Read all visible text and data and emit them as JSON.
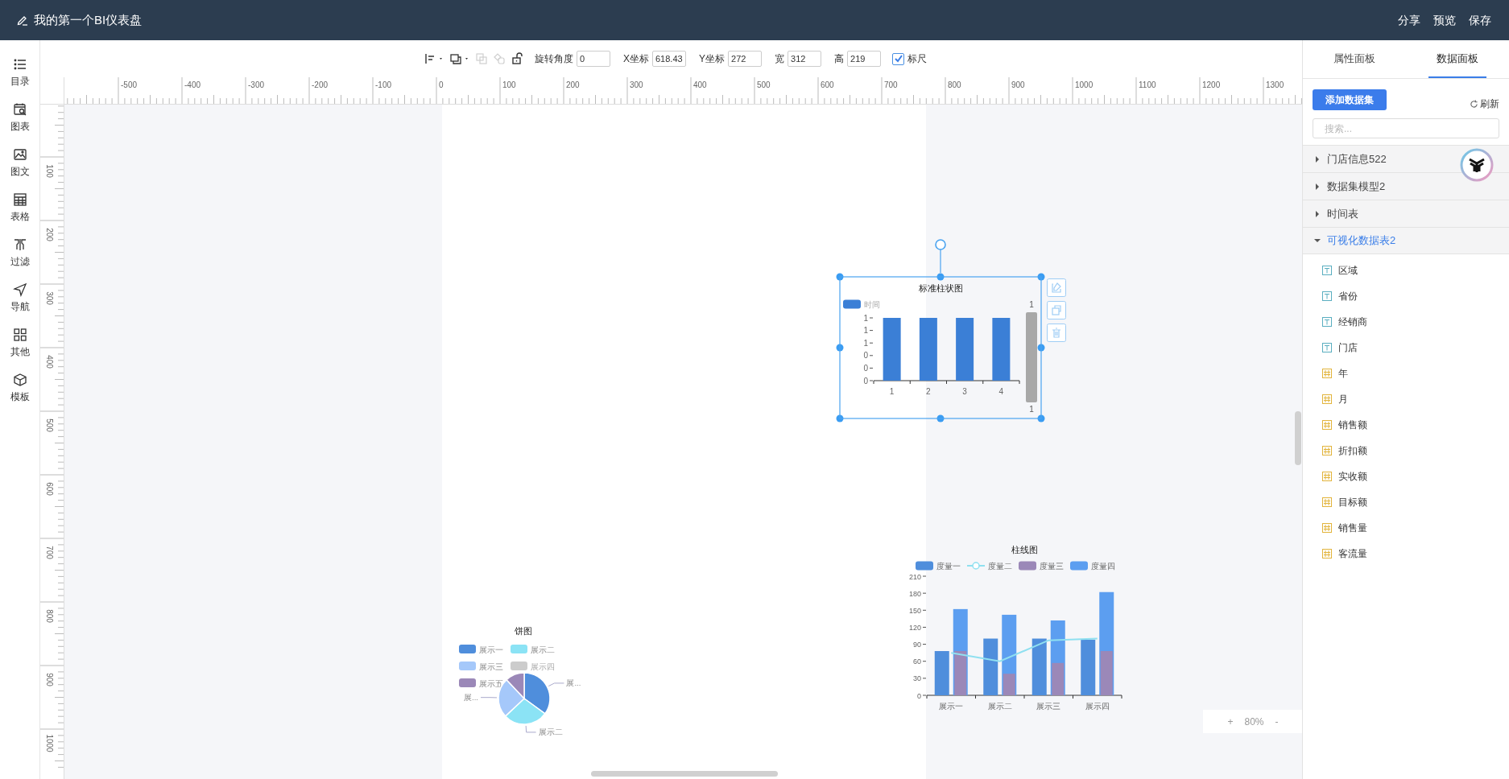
{
  "window": {
    "title": "我的第一个BI仪表盘"
  },
  "header_actions": [
    "分享",
    "预览",
    "保存"
  ],
  "sidebar": {
    "items": [
      {
        "label": "目录"
      },
      {
        "label": "图表"
      },
      {
        "label": "图文"
      },
      {
        "label": "表格"
      },
      {
        "label": "过滤"
      },
      {
        "label": "导航"
      },
      {
        "label": "其他"
      },
      {
        "label": "模板"
      }
    ]
  },
  "toolbar": {
    "tools": [
      {
        "disabled": false
      },
      {
        "disabled": false
      },
      {
        "disabled": true
      },
      {
        "disabled": true
      },
      {
        "disabled": false
      }
    ],
    "fields": [
      {
        "label": "旋转角度",
        "value": "0"
      },
      {
        "label": "X坐标",
        "value": "618.43"
      },
      {
        "label": "Y坐标",
        "value": "272"
      },
      {
        "label": "宽",
        "value": "312"
      },
      {
        "label": "高",
        "value": "219"
      }
    ],
    "ruler_toggle": {
      "label": "标尺",
      "checked": true
    }
  },
  "ruler": {
    "top_labels": [
      "-500",
      "-400",
      "-300",
      "-200",
      "-100",
      "0",
      "100",
      "200",
      "300",
      "400",
      "500",
      "600",
      "700",
      "800",
      "900",
      "1000",
      "1100",
      "1200",
      "1300"
    ],
    "left_labels": [
      "100",
      "200",
      "300",
      "400",
      "500",
      "600",
      "700",
      "800",
      "900",
      "1000"
    ]
  },
  "widgets": [
    {
      "selected": true,
      "slider": {
        "start": "1",
        "end": "1"
      },
      "chart_data": {
        "type": "bar",
        "title": "标准柱状图",
        "legend": "top-left",
        "categories": [
          "1",
          "2",
          "3",
          "4"
        ],
        "series": [
          {
            "name": "时间",
            "color": "#3b7fd6",
            "values": [
              1,
              1,
              1,
              1
            ]
          }
        ],
        "ylim": [
          0,
          1
        ],
        "yticks": [
          {
            "value": 0,
            "label": "0"
          },
          {
            "value": 0.2,
            "label": "0"
          },
          {
            "value": 0.4,
            "label": "0"
          },
          {
            "value": 0.6,
            "label": "1"
          },
          {
            "value": 0.8,
            "label": "1"
          },
          {
            "value": 1,
            "label": "1"
          }
        ]
      }
    },
    {
      "selected": false,
      "chart_data": {
        "type": "bar",
        "title": "柱线图",
        "legend": "top",
        "categories": [
          "展示一",
          "展示二",
          "展示三",
          "展示四"
        ],
        "ylim": [
          0,
          210
        ],
        "yticks": [
          0,
          30,
          60,
          90,
          120,
          150,
          180,
          210
        ],
        "series": [
          {
            "name": "度量一",
            "type": "bar",
            "color": "#4f8edc",
            "values": [
              78,
              100,
              100,
              98
            ]
          },
          {
            "name": "度量二",
            "type": "line",
            "color": "#8fe0f0",
            "values": [
              75,
              60,
              97,
              100
            ]
          },
          {
            "name": "度量三",
            "type": "bar",
            "color": "#9b88b8",
            "values": [
              78,
              38,
              57,
              78
            ]
          },
          {
            "name": "度量四",
            "type": "bar",
            "color": "#5c9ef0",
            "values": [
              152,
              142,
              132,
              182
            ]
          }
        ]
      }
    },
    {
      "selected": false,
      "slices": [
        {
          "color": "#4f8edc",
          "hidden": false,
          "label": "展..."
        },
        {
          "color": "#8be3f5",
          "hidden": false,
          "label": "展示二"
        },
        {
          "color": "#a5c8fa",
          "hidden": false,
          "label": "展..."
        },
        {
          "hidden": true
        },
        {
          "color": "#9b88b8",
          "hidden": false
        }
      ],
      "chart_data": {
        "type": "pie",
        "title": "饼图",
        "legend": "top-left",
        "categories": [
          "展示一",
          "展示二",
          "展示三",
          "展示四",
          "展示五"
        ],
        "values": [
          35,
          28,
          25,
          null,
          12
        ]
      }
    }
  ],
  "zoom": {
    "plus": "+",
    "value": "80%",
    "minus": "-"
  },
  "right_panel": {
    "tabs": [
      {
        "label": "属性面板",
        "selected": false
      },
      {
        "label": "数据面板",
        "selected": true
      }
    ],
    "add_button": "添加数据集",
    "refresh": "刷新",
    "search": {
      "placeholder": "搜索..."
    },
    "datasets": [
      {
        "name": "门店信息522",
        "expanded": false
      },
      {
        "name": "数据集模型2",
        "expanded": false
      },
      {
        "name": "时间表",
        "expanded": false
      },
      {
        "name": "可视化数据表2",
        "expanded": true,
        "children": [
          {
            "name": "区域",
            "kind": "text"
          },
          {
            "name": "省份",
            "kind": "text"
          },
          {
            "name": "经销商",
            "kind": "text"
          },
          {
            "name": "门店",
            "kind": "text"
          },
          {
            "name": "年",
            "kind": "number"
          },
          {
            "name": "月",
            "kind": "number"
          },
          {
            "name": "销售额",
            "kind": "number"
          },
          {
            "name": "折扣额",
            "kind": "number"
          },
          {
            "name": "实收额",
            "kind": "number"
          },
          {
            "name": "目标额",
            "kind": "number"
          },
          {
            "name": "销售量",
            "kind": "number"
          },
          {
            "name": "客流量",
            "kind": "number"
          }
        ]
      }
    ]
  }
}
